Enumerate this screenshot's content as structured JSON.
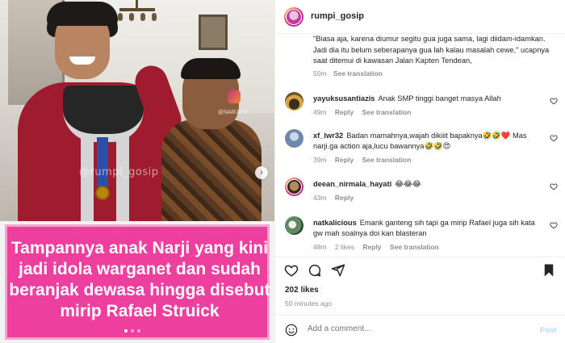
{
  "post": {
    "username": "rumpi_gosip",
    "watermark": "@rumpi_gosip",
    "watermark_small": "@NARJITV",
    "caption_overlay": "Tampannya anak Narji yang kini jadi idola warganet dan sudah beranjak dewasa hingga disebut mirip Rafael Struick",
    "carousel": {
      "count": 3,
      "active_index": 0
    }
  },
  "caption_comment": {
    "body": "\"Biasa aja, karena diumur segitu gua juga sama, lagi diidam-idamkan. Jadi dia itu belum seberapanya gua lah kalau masalah cewe,\" ucapnya saat ditemui di kawasan Jalan Kapten Tendean,",
    "time": "50m",
    "see_translation": "See translation"
  },
  "comments": [
    {
      "user": "yayuksusantiazis",
      "text": "Anak SMP tinggi banget masya Allah",
      "time": "49m",
      "reply": "Reply",
      "see_translation": "See translation",
      "likes": "",
      "avatar_color": "#c7a25a"
    },
    {
      "user": "xf_lwr32",
      "text": "Badan mamahnya,wajah dikiiit bapaknya🤣🤣❤️ Mas narji.ga action aja,lucu bawannya🤣🤣😍",
      "time": "39m",
      "reply": "Reply",
      "see_translation": "See translation",
      "likes": "",
      "avatar_color": "#7a8fb0"
    },
    {
      "user": "deean_nirmala_hayati",
      "text": "😂😂😂",
      "time": "43m",
      "reply": "Reply",
      "see_translation": "",
      "likes": "",
      "avatar_color": "#b28a5c"
    },
    {
      "user": "natkalicious",
      "text": "Emank ganteng sih tapi ga mirip Rafael juga sih kata gw mah soalnya doi kan blasteran",
      "time": "48m",
      "reply": "Reply",
      "see_translation": "See translation",
      "likes": "2 likes",
      "avatar_color": "#5e8a63"
    }
  ],
  "footer": {
    "likes": "202 likes",
    "time": "50 minutes ago",
    "add_comment_placeholder": "Add a comment...",
    "post_label": "Post"
  },
  "icons": {
    "like": "heart-icon",
    "comment": "comment-icon",
    "share": "share-icon",
    "save": "bookmark-icon",
    "emoji": "emoji-icon",
    "next": "chevron-right-icon"
  }
}
